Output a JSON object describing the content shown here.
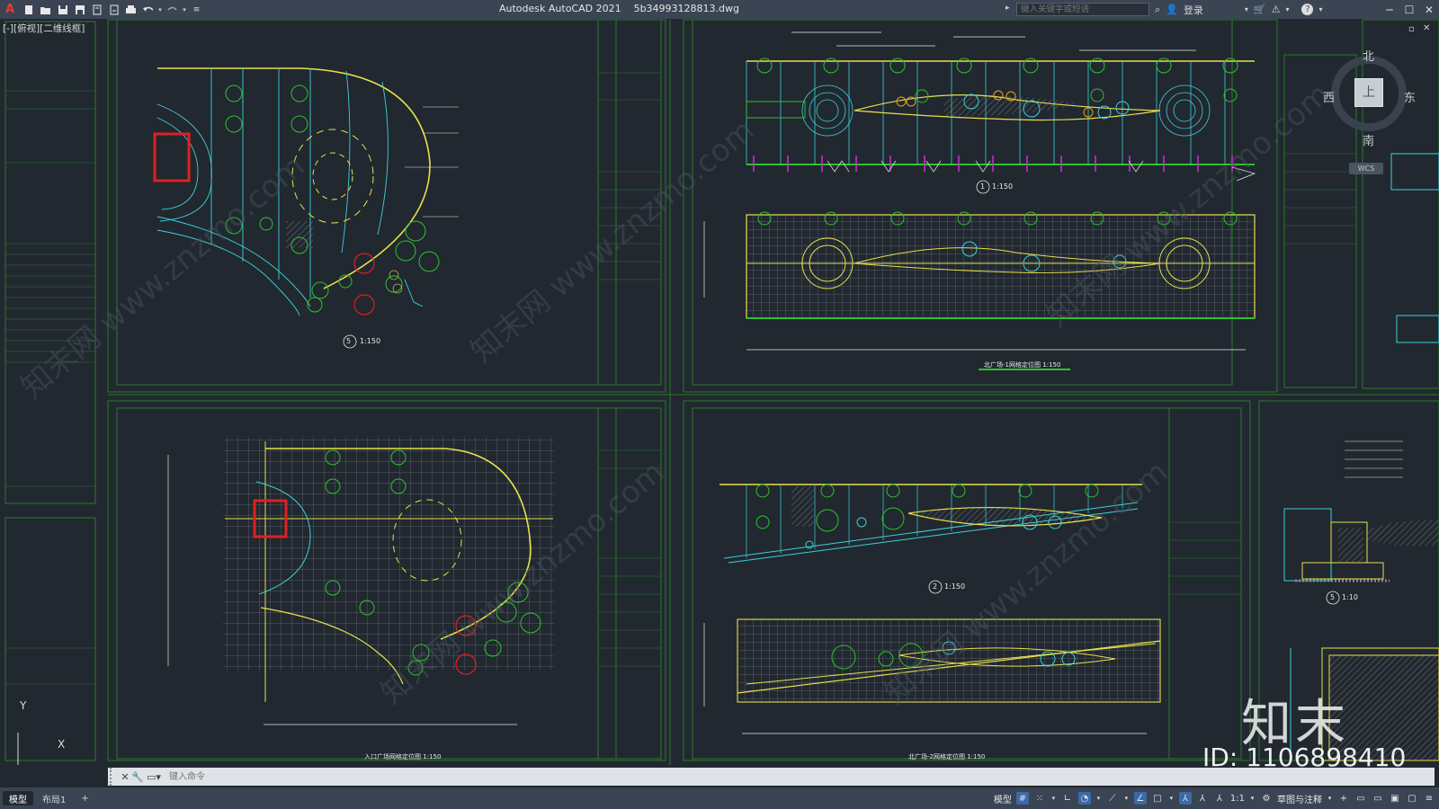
{
  "app": {
    "title": "Autodesk AutoCAD 2021    5b34993128813.dwg",
    "logo": "A",
    "search_placeholder": "键入关键字或短语",
    "login": "登录",
    "help": "?",
    "accent": "#e53935"
  },
  "quick_access": {
    "icons": [
      "new-icon",
      "open-icon",
      "save-icon",
      "saveas-icon",
      "open-web-icon",
      "save-web-icon",
      "plot-icon",
      "undo-icon",
      "redo-icon",
      "customize-icon"
    ]
  },
  "viewport": {
    "label": "[-][俯视][二维线框]"
  },
  "viewcube": {
    "north": "北",
    "south": "南",
    "east": "东",
    "west": "西",
    "top": "上",
    "wcs": "WCS"
  },
  "drawings": {
    "scale_5": "1:150",
    "scale_1": "1:150",
    "scale_2": "1:150",
    "scale_detail": "1:10",
    "grid_title_1": "北广场-1网格定位图 1:150",
    "grid_title_2": "入口广场网格定位图 1:150",
    "grid_title_3": "北广场-2网格定位图 1:150",
    "bubble_5": "5",
    "bubble_1": "1",
    "bubble_2": "2",
    "bubble_detail": "5"
  },
  "command": {
    "placeholder": "键入命令"
  },
  "layout_tabs": [
    "模型",
    "布局1",
    "+"
  ],
  "status": {
    "model": "模型",
    "scale": "1:1",
    "workspace": "草图与注释"
  },
  "watermark": {
    "brand": "知末",
    "id": "ID: 1106898410",
    "repeat": "知末网 www.znzmo.com"
  },
  "colors": {
    "cad_bg": "#212830",
    "line_yellow": "#e8e04a",
    "line_cyan": "#3fd0d8",
    "line_green": "#2ec22e",
    "line_red": "#e02020",
    "line_magenta": "#d030d0",
    "line_white": "#e8e8e8",
    "frame_green": "#2a7a2a"
  }
}
